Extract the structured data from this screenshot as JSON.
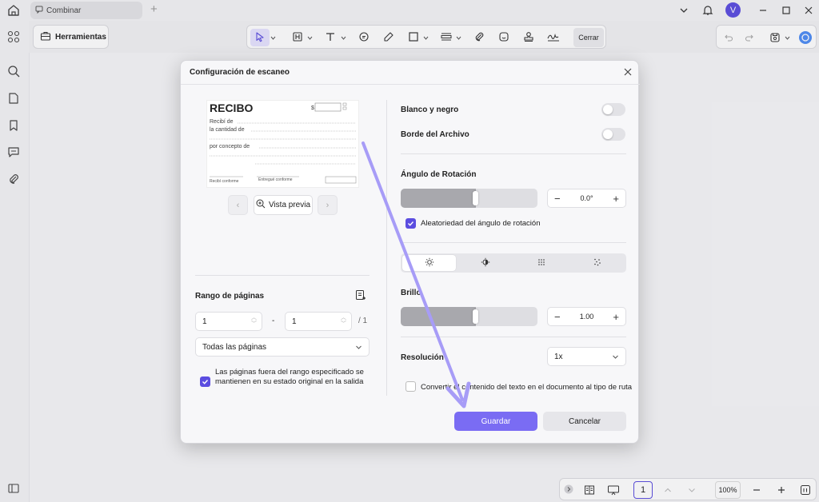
{
  "tab": {
    "title": "Combinar"
  },
  "user": {
    "initial": "V"
  },
  "toolbar": {
    "herramientas": "Herramientas",
    "close": "Cerrar"
  },
  "footer": {
    "page": "1",
    "zoom": "100%"
  },
  "dialog": {
    "title": "Configuración de escaneo",
    "preview": {
      "button": "Vista previa",
      "receipt_title": "RECIBO",
      "receipt_lines": [
        "Recibí de",
        "la cantidad de",
        "por concepto de"
      ],
      "receipt_footer_left": "Recibí conforme",
      "receipt_footer_mid": "Entregué conforme"
    },
    "page_range": {
      "label": "Rango de páginas",
      "from": "1",
      "dash": "-",
      "to": "1",
      "total": "/ 1",
      "select": "Todas las páginas",
      "note": "Las páginas fuera del rango especificado se mantienen en su estado original en la salida",
      "note_checked": true
    },
    "black_white": {
      "label": "Blanco y negro",
      "on": false
    },
    "file_border": {
      "label": "Borde del Archivo",
      "on": false
    },
    "rotation": {
      "label": "Ángulo de Rotación",
      "value": "0.0°",
      "slider_level": 0.55,
      "random_label": "Aleatoriedad del ángulo de rotación",
      "random_checked": true
    },
    "brightness": {
      "label": "Brillo",
      "value": "1.00",
      "slider_level": 0.55
    },
    "resolution": {
      "label": "Resolución",
      "value": "1x"
    },
    "convert": {
      "label": "Convertir el contenido del texto en el documento al tipo de ruta",
      "checked": false
    },
    "save": "Guardar",
    "cancel": "Cancelar"
  },
  "colors": {
    "accent": "#5b4de0",
    "primary_button": "#7a6cf3",
    "arrow": "#a79cf7"
  }
}
